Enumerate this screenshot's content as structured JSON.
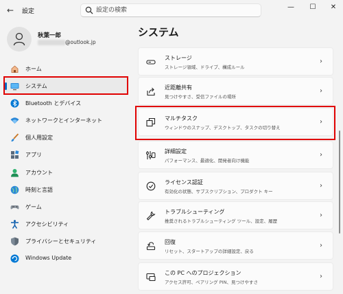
{
  "window": {
    "title": "設定",
    "back_glyph": "←",
    "minimize_glyph": "—",
    "maximize_glyph": "☐",
    "close_glyph": "✕"
  },
  "search": {
    "placeholder": "設定の検索"
  },
  "profile": {
    "name": "秋葉一郎",
    "email_suffix": "@outlook.jp"
  },
  "sidebar": {
    "selected_index": 1,
    "items": [
      {
        "label": "ホーム",
        "icon": "home-icon"
      },
      {
        "label": "システム",
        "icon": "system-icon"
      },
      {
        "label": "Bluetooth とデバイス",
        "icon": "bluetooth-icon"
      },
      {
        "label": "ネットワークとインターネット",
        "icon": "network-icon"
      },
      {
        "label": "個人用設定",
        "icon": "brush-icon"
      },
      {
        "label": "アプリ",
        "icon": "apps-icon"
      },
      {
        "label": "アカウント",
        "icon": "account-icon"
      },
      {
        "label": "時刻と言語",
        "icon": "time-language-icon"
      },
      {
        "label": "ゲーム",
        "icon": "gamepad-icon"
      },
      {
        "label": "アクセシビリティ",
        "icon": "accessibility-icon"
      },
      {
        "label": "プライバシーとセキュリティ",
        "icon": "shield-icon"
      },
      {
        "label": "Windows Update",
        "icon": "update-icon"
      }
    ]
  },
  "main": {
    "title": "システム",
    "cards": [
      {
        "title": "ストレージ",
        "subtitle": "ストレージ領域、ドライブ、構成ルール",
        "icon": "storage-icon"
      },
      {
        "title": "近距離共有",
        "subtitle": "見つけやすさ、受信ファイルの場所",
        "icon": "share-icon"
      },
      {
        "title": "マルチタスク",
        "subtitle": "ウィンドウのスナップ、デスクトップ、タスクの切り替え",
        "icon": "multitask-icon"
      },
      {
        "title": "詳細設定",
        "subtitle": "パフォーマンス、最適化、開発者向け機能",
        "icon": "advanced-settings-icon"
      },
      {
        "title": "ライセンス認証",
        "subtitle": "有効化の状態、サブスクリプション、プロダクト キー",
        "icon": "license-icon"
      },
      {
        "title": "トラブルシューティング",
        "subtitle": "推奨されるトラブルシューティング ツール、設定、履歴",
        "icon": "wrench-icon"
      },
      {
        "title": "回復",
        "subtitle": "リセット、スタートアップの詳細設定、戻る",
        "icon": "recovery-icon"
      },
      {
        "title": "この PC へのプロジェクション",
        "subtitle": "アクセス許可、ペアリング PIN、見つけやすさ",
        "icon": "projection-icon"
      }
    ],
    "chevron_glyph": "›"
  },
  "colors": {
    "accent": "#0067c0",
    "highlight": "#e00000",
    "background": "#f3f3f3",
    "card": "#fbfbfb"
  }
}
